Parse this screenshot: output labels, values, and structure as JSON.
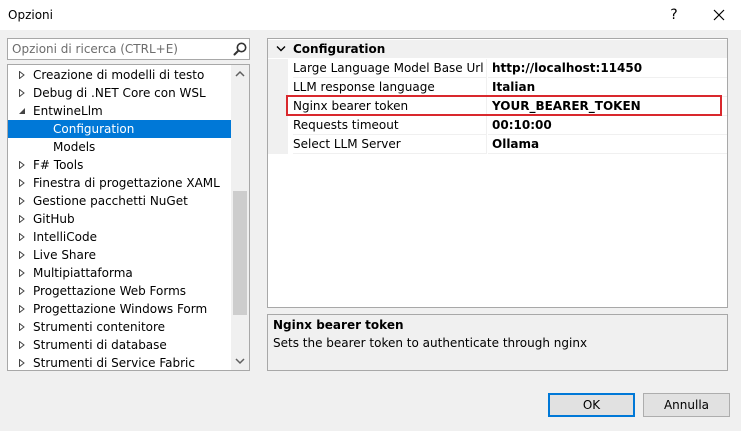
{
  "window": {
    "title": "Opzioni",
    "help_label": "?"
  },
  "search": {
    "placeholder": "Opzioni di ricerca (CTRL+E)"
  },
  "tree": {
    "items": [
      {
        "label": "Creazione di modelli di testo",
        "level": 0,
        "expander": "collapsed",
        "selected": false
      },
      {
        "label": "Debug di .NET Core con WSL",
        "level": 0,
        "expander": "collapsed",
        "selected": false
      },
      {
        "label": "EntwineLlm",
        "level": 0,
        "expander": "expanded",
        "selected": false
      },
      {
        "label": "Configuration",
        "level": 1,
        "expander": "none",
        "selected": true
      },
      {
        "label": "Models",
        "level": 1,
        "expander": "none",
        "selected": false
      },
      {
        "label": "F# Tools",
        "level": 0,
        "expander": "collapsed",
        "selected": false
      },
      {
        "label": "Finestra di progettazione XAML",
        "level": 0,
        "expander": "collapsed",
        "selected": false
      },
      {
        "label": "Gestione pacchetti NuGet",
        "level": 0,
        "expander": "collapsed",
        "selected": false
      },
      {
        "label": "GitHub",
        "level": 0,
        "expander": "collapsed",
        "selected": false
      },
      {
        "label": "IntelliCode",
        "level": 0,
        "expander": "collapsed",
        "selected": false
      },
      {
        "label": "Live Share",
        "level": 0,
        "expander": "collapsed",
        "selected": false
      },
      {
        "label": "Multipiattaforma",
        "level": 0,
        "expander": "collapsed",
        "selected": false
      },
      {
        "label": "Progettazione Web Forms",
        "level": 0,
        "expander": "collapsed",
        "selected": false
      },
      {
        "label": "Progettazione Windows Form",
        "level": 0,
        "expander": "collapsed",
        "selected": false
      },
      {
        "label": "Strumenti contenitore",
        "level": 0,
        "expander": "collapsed",
        "selected": false
      },
      {
        "label": "Strumenti di database",
        "level": 0,
        "expander": "collapsed",
        "selected": false
      },
      {
        "label": "Strumenti di Service Fabric",
        "level": 0,
        "expander": "collapsed",
        "selected": false
      }
    ]
  },
  "properties": {
    "category": "Configuration",
    "rows": [
      {
        "name": "Large Language Model Base Url",
        "value": "http://localhost:11450"
      },
      {
        "name": "LLM response language",
        "value": "Italian"
      },
      {
        "name": "Nginx bearer token",
        "value": "YOUR_BEARER_TOKEN"
      },
      {
        "name": "Requests timeout",
        "value": "00:10:00"
      },
      {
        "name": "Select LLM Server",
        "value": "Ollama"
      }
    ],
    "highlighted_row": "Nginx bearer token"
  },
  "description": {
    "title": "Nginx bearer token",
    "text": "Sets the bearer token to authenticate through nginx"
  },
  "buttons": {
    "ok_label": "OK",
    "cancel_label": "Annulla"
  },
  "colors": {
    "selection": "#0078d7",
    "highlight_border": "#d9282d"
  }
}
